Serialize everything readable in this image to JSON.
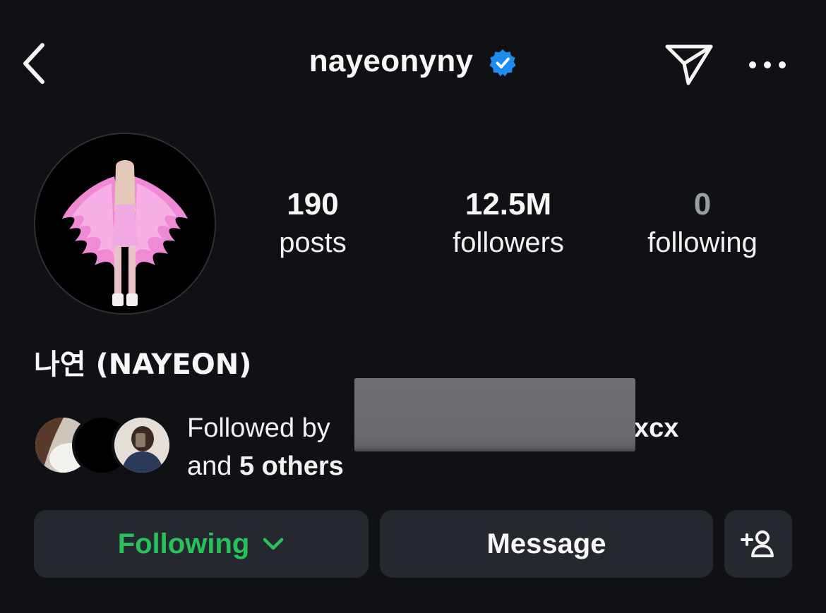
{
  "header": {
    "username": "nayeonyny",
    "back_icon": "chevron-left-icon",
    "verified_icon": "verified-badge-icon",
    "send_icon": "paper-plane-icon",
    "more_icon": "more-horizontal-icon"
  },
  "profile": {
    "display_name": "나연 (NAYEON)",
    "stats": {
      "posts": {
        "value": "190",
        "label": "posts"
      },
      "followers": {
        "value": "12.5M",
        "label": "followers"
      },
      "following": {
        "value": "0",
        "label": "following"
      }
    }
  },
  "followed_by": {
    "prefix": "Followed by",
    "visible_name_tail": "xcx",
    "and_text": "and",
    "others": "5 others"
  },
  "actions": {
    "following_label": "Following",
    "message_label": "Message",
    "add_user_icon": "add-person-icon"
  },
  "colors": {
    "background": "#0f1115",
    "button_bg": "#25282e",
    "following_green": "#27c25a",
    "verified_blue": "#1d8cf0"
  }
}
